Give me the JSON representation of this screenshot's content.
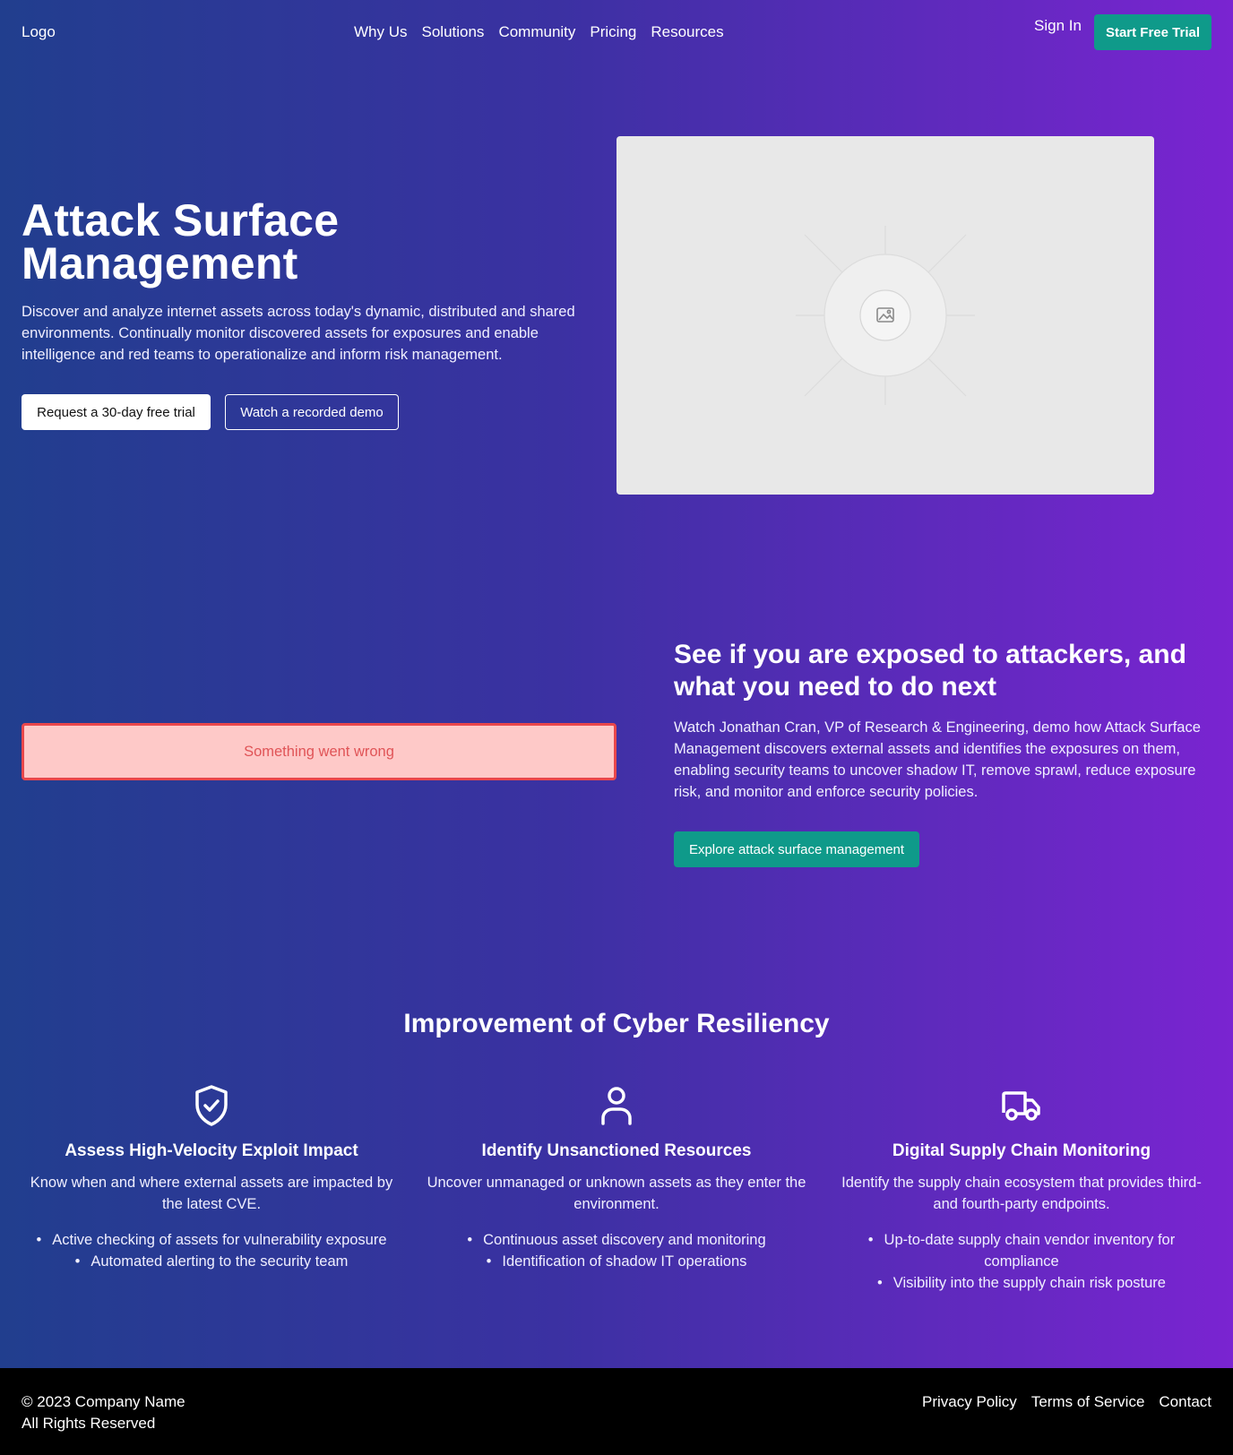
{
  "nav": {
    "logo": "Logo",
    "links": [
      "Why Us",
      "Solutions",
      "Community",
      "Pricing",
      "Resources"
    ],
    "sign_in": "Sign In",
    "cta": "Start Free Trial"
  },
  "hero": {
    "title": "Attack Surface Management",
    "description": "Discover and analyze internet assets across today's dynamic, distributed and shared environments. Continually monitor discovered assets for exposures and enable intelligence and red teams to operationalize and inform risk management.",
    "primary_button": "Request a 30-day free trial",
    "secondary_button": "Watch a recorded demo",
    "image_icon": "image-icon"
  },
  "expose": {
    "error_message": "Something went wrong",
    "title": "See if you are exposed to attackers, and what you need to do next",
    "description": "Watch Jonathan Cran, VP of Research & Engineering, demo how Attack Surface Management discovers external assets and identifies the exposures on them, enabling security teams to uncover shadow IT, remove sprawl, reduce exposure risk, and monitor and enforce security policies.",
    "button": "Explore attack surface management"
  },
  "features": {
    "title": "Improvement of Cyber Resiliency",
    "items": [
      {
        "icon": "shield-check-icon",
        "title": "Assess High-Velocity Exploit Impact",
        "description": "Know when and where external assets are impacted by the latest CVE.",
        "bullets": [
          "Active checking of assets for vulnerability exposure",
          "Automated alerting to the security team"
        ]
      },
      {
        "icon": "user-icon",
        "title": "Identify Unsanctioned Resources",
        "description": "Uncover unmanaged or unknown assets as they enter the environment.",
        "bullets": [
          "Continuous asset discovery and monitoring",
          "Identification of shadow IT operations"
        ]
      },
      {
        "icon": "truck-icon",
        "title": "Digital Supply Chain Monitoring",
        "description": "Identify the supply chain ecosystem that provides third- and fourth-party endpoints.",
        "bullets": [
          "Up-to-date supply chain vendor inventory for compliance",
          "Visibility into the supply chain risk posture"
        ]
      }
    ]
  },
  "footer": {
    "copyright": "© 2023 Company Name",
    "rights": "All Rights Reserved",
    "links": [
      "Privacy Policy",
      "Terms of Service",
      "Contact"
    ]
  },
  "colors": {
    "gradient_start": "#213e8e",
    "gradient_end": "#7a24d1",
    "accent": "#0f9a8a",
    "error_bg": "#fec9c8",
    "error_border": "#e9474b"
  }
}
